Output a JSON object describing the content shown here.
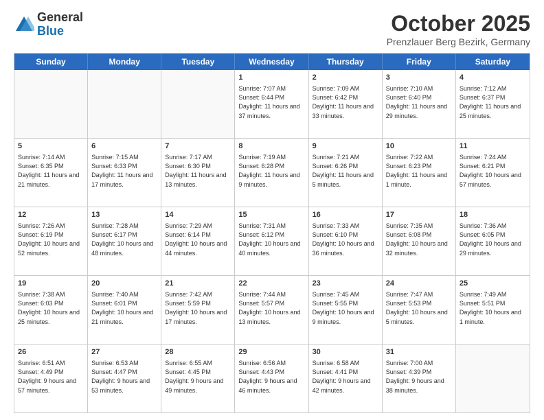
{
  "header": {
    "logo_general": "General",
    "logo_blue": "Blue",
    "month_title": "October 2025",
    "subtitle": "Prenzlauer Berg Bezirk, Germany"
  },
  "weekdays": [
    "Sunday",
    "Monday",
    "Tuesday",
    "Wednesday",
    "Thursday",
    "Friday",
    "Saturday"
  ],
  "rows": [
    [
      {
        "day": "",
        "sunrise": "",
        "sunset": "",
        "daylight": "",
        "empty": true
      },
      {
        "day": "",
        "sunrise": "",
        "sunset": "",
        "daylight": "",
        "empty": true
      },
      {
        "day": "",
        "sunrise": "",
        "sunset": "",
        "daylight": "",
        "empty": true
      },
      {
        "day": "1",
        "sunrise": "Sunrise: 7:07 AM",
        "sunset": "Sunset: 6:44 PM",
        "daylight": "Daylight: 11 hours and 37 minutes."
      },
      {
        "day": "2",
        "sunrise": "Sunrise: 7:09 AM",
        "sunset": "Sunset: 6:42 PM",
        "daylight": "Daylight: 11 hours and 33 minutes."
      },
      {
        "day": "3",
        "sunrise": "Sunrise: 7:10 AM",
        "sunset": "Sunset: 6:40 PM",
        "daylight": "Daylight: 11 hours and 29 minutes."
      },
      {
        "day": "4",
        "sunrise": "Sunrise: 7:12 AM",
        "sunset": "Sunset: 6:37 PM",
        "daylight": "Daylight: 11 hours and 25 minutes."
      }
    ],
    [
      {
        "day": "5",
        "sunrise": "Sunrise: 7:14 AM",
        "sunset": "Sunset: 6:35 PM",
        "daylight": "Daylight: 11 hours and 21 minutes."
      },
      {
        "day": "6",
        "sunrise": "Sunrise: 7:15 AM",
        "sunset": "Sunset: 6:33 PM",
        "daylight": "Daylight: 11 hours and 17 minutes."
      },
      {
        "day": "7",
        "sunrise": "Sunrise: 7:17 AM",
        "sunset": "Sunset: 6:30 PM",
        "daylight": "Daylight: 11 hours and 13 minutes."
      },
      {
        "day": "8",
        "sunrise": "Sunrise: 7:19 AM",
        "sunset": "Sunset: 6:28 PM",
        "daylight": "Daylight: 11 hours and 9 minutes."
      },
      {
        "day": "9",
        "sunrise": "Sunrise: 7:21 AM",
        "sunset": "Sunset: 6:26 PM",
        "daylight": "Daylight: 11 hours and 5 minutes."
      },
      {
        "day": "10",
        "sunrise": "Sunrise: 7:22 AM",
        "sunset": "Sunset: 6:23 PM",
        "daylight": "Daylight: 11 hours and 1 minute."
      },
      {
        "day": "11",
        "sunrise": "Sunrise: 7:24 AM",
        "sunset": "Sunset: 6:21 PM",
        "daylight": "Daylight: 10 hours and 57 minutes."
      }
    ],
    [
      {
        "day": "12",
        "sunrise": "Sunrise: 7:26 AM",
        "sunset": "Sunset: 6:19 PM",
        "daylight": "Daylight: 10 hours and 52 minutes."
      },
      {
        "day": "13",
        "sunrise": "Sunrise: 7:28 AM",
        "sunset": "Sunset: 6:17 PM",
        "daylight": "Daylight: 10 hours and 48 minutes."
      },
      {
        "day": "14",
        "sunrise": "Sunrise: 7:29 AM",
        "sunset": "Sunset: 6:14 PM",
        "daylight": "Daylight: 10 hours and 44 minutes."
      },
      {
        "day": "15",
        "sunrise": "Sunrise: 7:31 AM",
        "sunset": "Sunset: 6:12 PM",
        "daylight": "Daylight: 10 hours and 40 minutes."
      },
      {
        "day": "16",
        "sunrise": "Sunrise: 7:33 AM",
        "sunset": "Sunset: 6:10 PM",
        "daylight": "Daylight: 10 hours and 36 minutes."
      },
      {
        "day": "17",
        "sunrise": "Sunrise: 7:35 AM",
        "sunset": "Sunset: 6:08 PM",
        "daylight": "Daylight: 10 hours and 32 minutes."
      },
      {
        "day": "18",
        "sunrise": "Sunrise: 7:36 AM",
        "sunset": "Sunset: 6:05 PM",
        "daylight": "Daylight: 10 hours and 29 minutes."
      }
    ],
    [
      {
        "day": "19",
        "sunrise": "Sunrise: 7:38 AM",
        "sunset": "Sunset: 6:03 PM",
        "daylight": "Daylight: 10 hours and 25 minutes."
      },
      {
        "day": "20",
        "sunrise": "Sunrise: 7:40 AM",
        "sunset": "Sunset: 6:01 PM",
        "daylight": "Daylight: 10 hours and 21 minutes."
      },
      {
        "day": "21",
        "sunrise": "Sunrise: 7:42 AM",
        "sunset": "Sunset: 5:59 PM",
        "daylight": "Daylight: 10 hours and 17 minutes."
      },
      {
        "day": "22",
        "sunrise": "Sunrise: 7:44 AM",
        "sunset": "Sunset: 5:57 PM",
        "daylight": "Daylight: 10 hours and 13 minutes."
      },
      {
        "day": "23",
        "sunrise": "Sunrise: 7:45 AM",
        "sunset": "Sunset: 5:55 PM",
        "daylight": "Daylight: 10 hours and 9 minutes."
      },
      {
        "day": "24",
        "sunrise": "Sunrise: 7:47 AM",
        "sunset": "Sunset: 5:53 PM",
        "daylight": "Daylight: 10 hours and 5 minutes."
      },
      {
        "day": "25",
        "sunrise": "Sunrise: 7:49 AM",
        "sunset": "Sunset: 5:51 PM",
        "daylight": "Daylight: 10 hours and 1 minute."
      }
    ],
    [
      {
        "day": "26",
        "sunrise": "Sunrise: 6:51 AM",
        "sunset": "Sunset: 4:49 PM",
        "daylight": "Daylight: 9 hours and 57 minutes."
      },
      {
        "day": "27",
        "sunrise": "Sunrise: 6:53 AM",
        "sunset": "Sunset: 4:47 PM",
        "daylight": "Daylight: 9 hours and 53 minutes."
      },
      {
        "day": "28",
        "sunrise": "Sunrise: 6:55 AM",
        "sunset": "Sunset: 4:45 PM",
        "daylight": "Daylight: 9 hours and 49 minutes."
      },
      {
        "day": "29",
        "sunrise": "Sunrise: 6:56 AM",
        "sunset": "Sunset: 4:43 PM",
        "daylight": "Daylight: 9 hours and 46 minutes."
      },
      {
        "day": "30",
        "sunrise": "Sunrise: 6:58 AM",
        "sunset": "Sunset: 4:41 PM",
        "daylight": "Daylight: 9 hours and 42 minutes."
      },
      {
        "day": "31",
        "sunrise": "Sunrise: 7:00 AM",
        "sunset": "Sunset: 4:39 PM",
        "daylight": "Daylight: 9 hours and 38 minutes."
      },
      {
        "day": "",
        "sunrise": "",
        "sunset": "",
        "daylight": "",
        "empty": true
      }
    ]
  ]
}
